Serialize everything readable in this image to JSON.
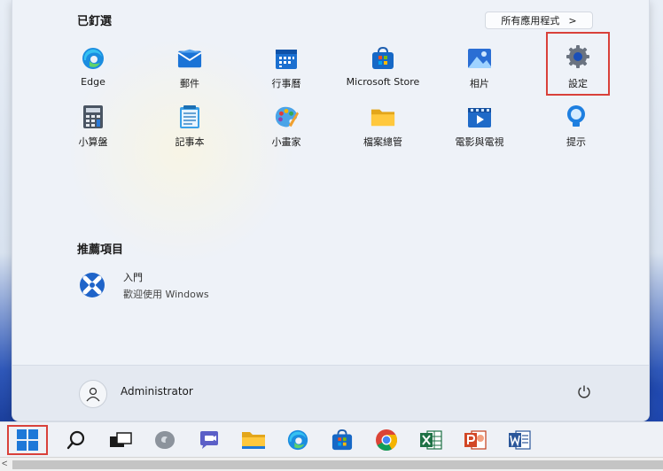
{
  "start_menu": {
    "pinned_title": "已釘選",
    "all_apps_label": "所有應用程式",
    "all_apps_chevron": ">",
    "pinned_apps": [
      {
        "label": "Edge",
        "icon": "edge-icon"
      },
      {
        "label": "郵件",
        "icon": "mail-icon"
      },
      {
        "label": "行事曆",
        "icon": "calendar-icon"
      },
      {
        "label": "Microsoft Store",
        "icon": "store-icon"
      },
      {
        "label": "相片",
        "icon": "photos-icon"
      },
      {
        "label": "設定",
        "icon": "settings-gear-icon"
      },
      {
        "label": "小算盤",
        "icon": "calculator-icon"
      },
      {
        "label": "記事本",
        "icon": "notepad-icon"
      },
      {
        "label": "小畫家",
        "icon": "paint-icon"
      },
      {
        "label": "檔案總管",
        "icon": "file-explorer-icon"
      },
      {
        "label": "電影與電視",
        "icon": "movies-tv-icon"
      },
      {
        "label": "提示",
        "icon": "tips-icon"
      }
    ],
    "recommended_title": "推薦項目",
    "recommended": [
      {
        "title": "入門",
        "subtitle": "歡迎使用 Windows",
        "icon": "get-started-icon"
      }
    ],
    "user_name": "Administrator",
    "power_icon": "power-icon"
  },
  "taskbar": {
    "icons": [
      "start-icon",
      "search-icon",
      "task-view-icon",
      "widgets-icon",
      "chat-icon",
      "file-explorer-icon",
      "edge-icon",
      "store-icon",
      "chrome-icon",
      "excel-icon",
      "powerpoint-icon",
      "word-icon"
    ]
  },
  "scrollbar": {
    "left_arrow": "<"
  },
  "colors": {
    "highlight": "#d9413a",
    "accent": "#0067c0"
  }
}
